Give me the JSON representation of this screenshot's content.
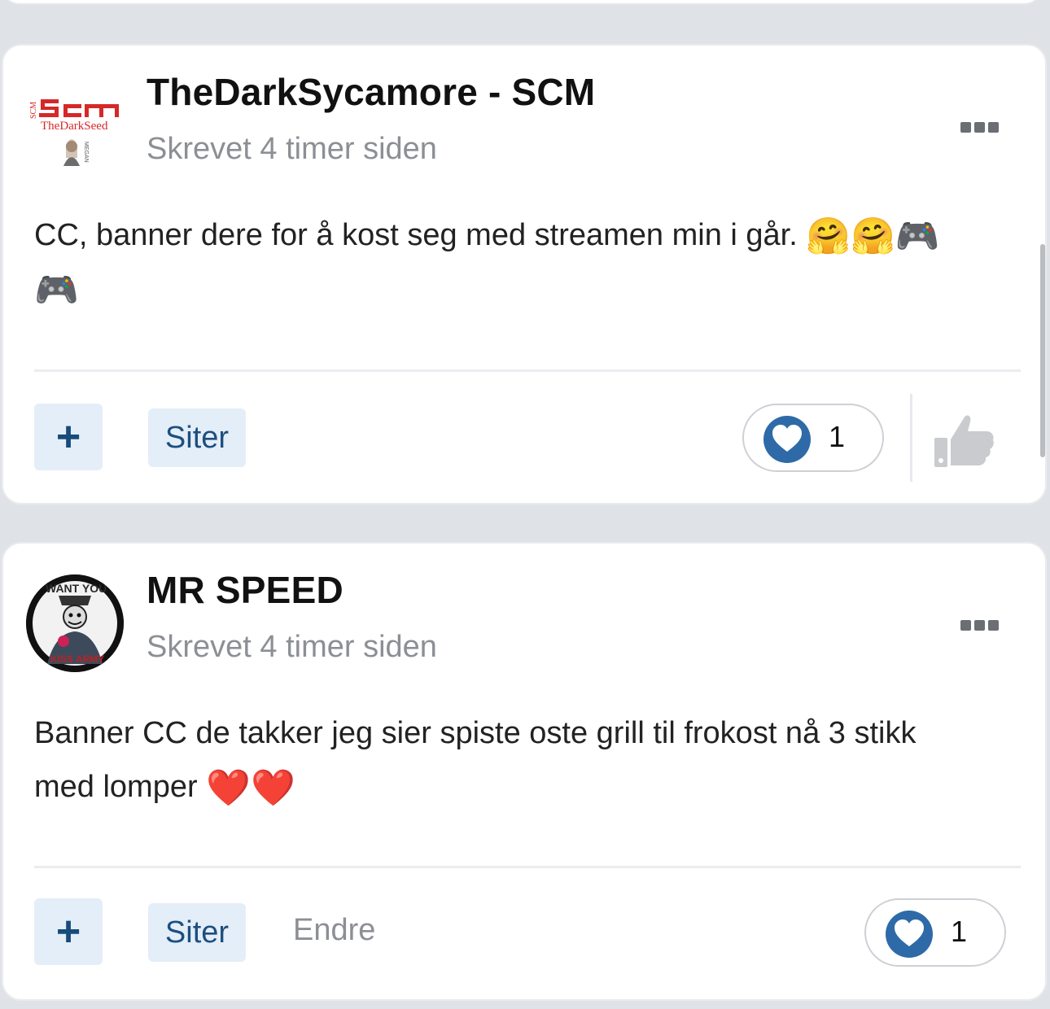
{
  "posts": [
    {
      "author": "TheDarkSycamore - SCM",
      "timestamp": "Skrevet 4 timer siden",
      "body": "CC, banner dere for å kost seg med streamen min i går.",
      "emojis": "🤗🤗🎮",
      "emojis_line2": "🎮",
      "avatar_text_main": "TheDarkSeed",
      "avatar_text_side": "SCM",
      "avatar_text_small": "MEGAN",
      "plus_label": "+",
      "quote_label": "Siter",
      "reaction_count": "1",
      "has_thumb": true
    },
    {
      "author": "MR SPEED",
      "timestamp": "Skrevet 4 timer siden",
      "body_line1": "Banner CC de takker jeg sier spiste oste grill til frokost nå 3 stikk",
      "body_line2": "med lomper",
      "emojis": "❤️❤️",
      "avatar_text_top": "WANT YOU",
      "avatar_text_bottom": "KISS ARMY",
      "plus_label": "+",
      "quote_label": "Siter",
      "edit_label": "Endre",
      "reaction_count": "1"
    }
  ],
  "colors": {
    "page_bg": "#dfe3e8",
    "button_bg": "#e4eef8",
    "button_text": "#1d4f80",
    "heart": "#2e6aa7",
    "muted": "#8c8f94"
  },
  "icons": [
    "more-icon",
    "plus-icon",
    "heart-icon",
    "thumbs-up-icon"
  ]
}
